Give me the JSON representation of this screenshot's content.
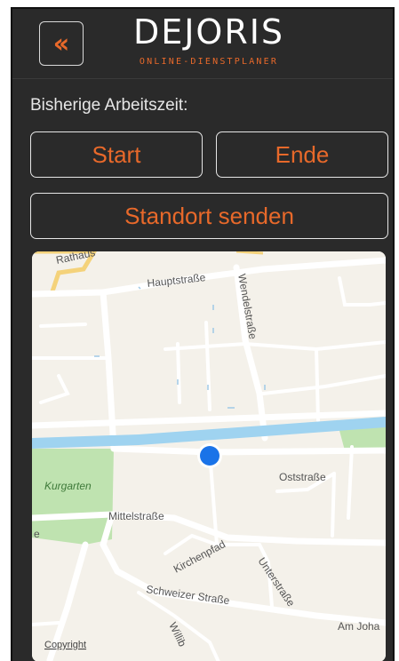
{
  "header": {
    "back_icon": "double-chevron-left-icon",
    "logo_title": "DEJORIS",
    "logo_subtitle": "ONLINE-DIENSTPLANER"
  },
  "work_time_label": "Bisherige Arbeitszeit:",
  "buttons": {
    "start": "Start",
    "end": "Ende",
    "send_location": "Standort senden"
  },
  "map": {
    "streets": {
      "rathaus": "Rathaus",
      "hauptstrasse": "Hauptstraße",
      "wendelstrasse": "Wendelstraße",
      "oststrasse": "Oststraße",
      "kurgarten": "Kurgarten",
      "mittelstrasse": "Mittelstraße",
      "kirchenpfad": "Kirchenpfad",
      "unterstrasse": "Unterstraße",
      "schweizer_strasse": "Schweizer Straße",
      "am_joha": "Am Joha",
      "willib": "Willib",
      "edge_e": "e"
    },
    "copyright": "Copyright",
    "location_marker": "current-location"
  },
  "colors": {
    "accent": "#e8692a",
    "background": "#2a2a2a",
    "river": "#9fd3f0",
    "park": "#bfe3b0",
    "marker": "#1a73e8"
  }
}
